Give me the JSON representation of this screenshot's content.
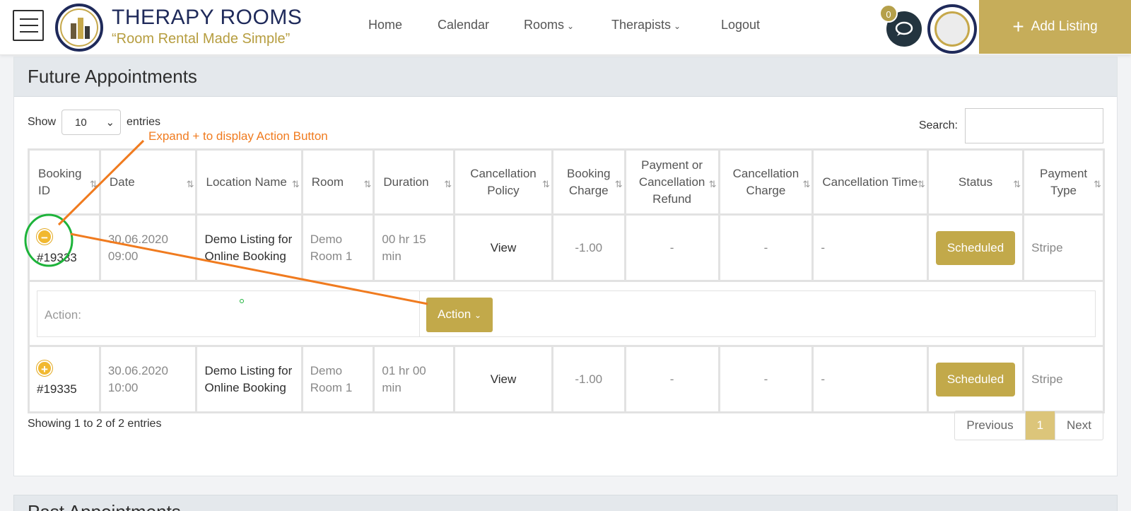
{
  "header": {
    "brand_title": "THERAPY ROOMS",
    "brand_subtitle": "“Room Rental Made Simple”",
    "nav": [
      "Home",
      "Calendar",
      "Rooms",
      "Therapists",
      "Logout"
    ],
    "chat_badge": "0",
    "add_listing": "Add Listing"
  },
  "future": {
    "title": "Future Appointments",
    "show_label": "Show",
    "entries_select": "10",
    "entries_label": "entries",
    "search_label": "Search:",
    "columns": [
      "Booking ID",
      "Date",
      "Location Name",
      "Room",
      "Duration",
      "Cancellation Policy",
      "Booking Charge",
      "Payment or Cancellation Refund",
      "Cancellation Charge",
      "Cancellation Time",
      "Status",
      "Payment Type"
    ],
    "rows": [
      {
        "id": "#19333",
        "date": "30.06.2020 09:00",
        "location": "Demo Listing for Online Booking",
        "room": "Demo Room 1",
        "duration": "00 hr 15 min",
        "policy": "View",
        "charge": "-1.00",
        "refund": "-",
        "cancel_charge": "-",
        "cancel_time": "-",
        "status": "Scheduled",
        "payment": "Stripe",
        "expanded": true
      },
      {
        "id": "#19335",
        "date": "30.06.2020 10:00",
        "location": "Demo Listing for Online Booking",
        "room": "Demo Room 1",
        "duration": "01 hr 00 min",
        "policy": "View",
        "charge": "-1.00",
        "refund": "-",
        "cancel_charge": "-",
        "cancel_time": "-",
        "status": "Scheduled",
        "payment": "Stripe",
        "expanded": false
      }
    ],
    "child_row": {
      "label": "Action:",
      "button": "Action"
    },
    "info": "Showing 1 to 2 of 2 entries",
    "pager": {
      "prev": "Previous",
      "page": "1",
      "next": "Next"
    }
  },
  "past": {
    "title": "Past Appointments"
  },
  "annotation": {
    "text": "Expand + to display Action Button",
    "color": "#f07b1f",
    "circle_color": "#1db33a"
  },
  "colors": {
    "gold": "#c2a94a",
    "navy": "#1f2a5a",
    "chat": "#23343f"
  }
}
